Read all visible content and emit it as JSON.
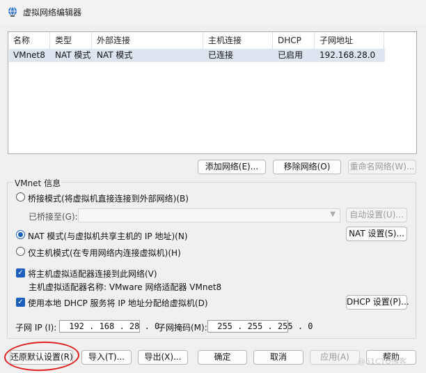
{
  "window": {
    "title": "虚拟网络编辑器"
  },
  "table": {
    "headers": [
      "名称",
      "类型",
      "外部连接",
      "主机连接",
      "DHCP",
      "子网地址"
    ],
    "rows": [
      [
        "VMnet8",
        "NAT 模式",
        "NAT 模式",
        "已连接",
        "已启用",
        "192.168.28.0"
      ]
    ]
  },
  "list_buttons": {
    "add": "添加网络(E)...",
    "remove": "移除网络(O)",
    "rename": "重命名网络(W)..."
  },
  "vmnet_info": {
    "label": "VMnet 信息",
    "bridged_label": "桥接模式(将虚拟机直接连接到外部网络)(B)",
    "bridged_to_label": "已桥接至(G):",
    "auto_settings": "自动设置(U)...",
    "nat_label": "NAT 模式(与虚拟机共享主机的 IP 地址)(N)",
    "nat_settings": "NAT 设置(S)...",
    "hostonly_label": "仅主机模式(在专用网络内连接虚拟机)(H)",
    "connect_adapter_label": "将主机虚拟适配器连接到此网络(V)",
    "adapter_name_text": "主机虚拟适配器名称: VMware 网络适配器 VMnet8",
    "dhcp_label": "使用本地 DHCP 服务将 IP 地址分配给虚拟机(D)",
    "dhcp_settings": "DHCP 设置(P)..."
  },
  "subnet": {
    "ip_label": "子网 IP (I):",
    "ip_value": " 192 . 168 . 28 . 0",
    "mask_label": "子网掩码(M):",
    "mask_value": " 255 . 255 . 255 . 0"
  },
  "footer": {
    "restore": "还原默认设置(R)",
    "import": "导入(T)...",
    "export": "导出(X)...",
    "ok": "确定",
    "cancel": "取消",
    "apply": "应用(A)",
    "help": "帮助"
  },
  "watermark": "@51CTO博客",
  "colors": {
    "accent": "#1d5fbf",
    "annotation": "#e02020",
    "selected_row": "#dde5ef"
  }
}
